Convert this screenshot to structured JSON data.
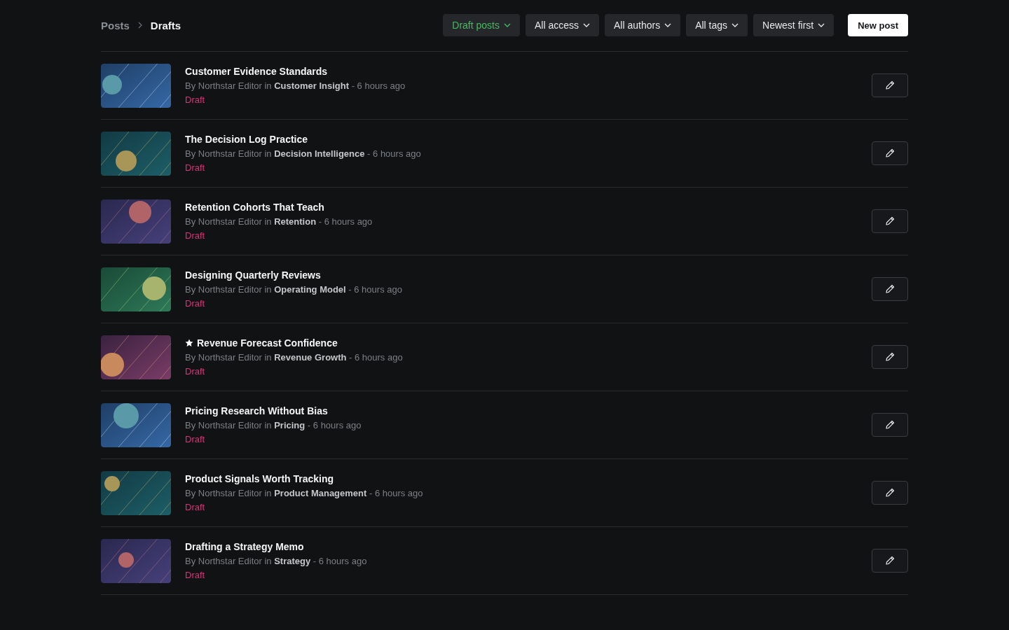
{
  "breadcrumb": [
    {
      "label": "Posts",
      "current": false
    },
    {
      "label": "Drafts",
      "current": true
    }
  ],
  "filters": [
    {
      "label": "Draft posts",
      "active": true
    },
    {
      "label": "All access",
      "active": false
    },
    {
      "label": "All authors",
      "active": false
    },
    {
      "label": "All tags",
      "active": false
    },
    {
      "label": "Newest first",
      "active": false
    }
  ],
  "new_post_button": "New post",
  "posts": [
    {
      "title": "Customer Evidence Standards",
      "featured": false,
      "meta": "By Northstar Editor in **Customer Insight** - 6 hours ago",
      "status": "Draft"
    },
    {
      "title": "The Decision Log Practice",
      "featured": false,
      "meta": "By Northstar Editor in **Decision Intelligence** - 6 hours ago",
      "status": "Draft"
    },
    {
      "title": "Retention Cohorts That Teach",
      "featured": false,
      "meta": "By Northstar Editor in **Retention** - 6 hours ago",
      "status": "Draft"
    },
    {
      "title": "Designing Quarterly Reviews",
      "featured": false,
      "meta": "By Northstar Editor in **Operating Model** - 6 hours ago",
      "status": "Draft"
    },
    {
      "title": "Revenue Forecast Confidence",
      "featured": true,
      "meta": "By Northstar Editor in **Revenue Growth** - 6 hours ago",
      "status": "Draft"
    },
    {
      "title": "Pricing Research Without Bias",
      "featured": false,
      "meta": "By Northstar Editor in **Pricing** - 6 hours ago",
      "status": "Draft"
    },
    {
      "title": "Product Signals Worth Tracking",
      "featured": false,
      "meta": "By Northstar Editor in **Product Management** - 6 hours ago",
      "status": "Draft"
    },
    {
      "title": "Drafting a Strategy Memo",
      "featured": false,
      "meta": "By Northstar Editor in **Strategy** - 6 hours ago",
      "status": "Draft"
    }
  ]
}
